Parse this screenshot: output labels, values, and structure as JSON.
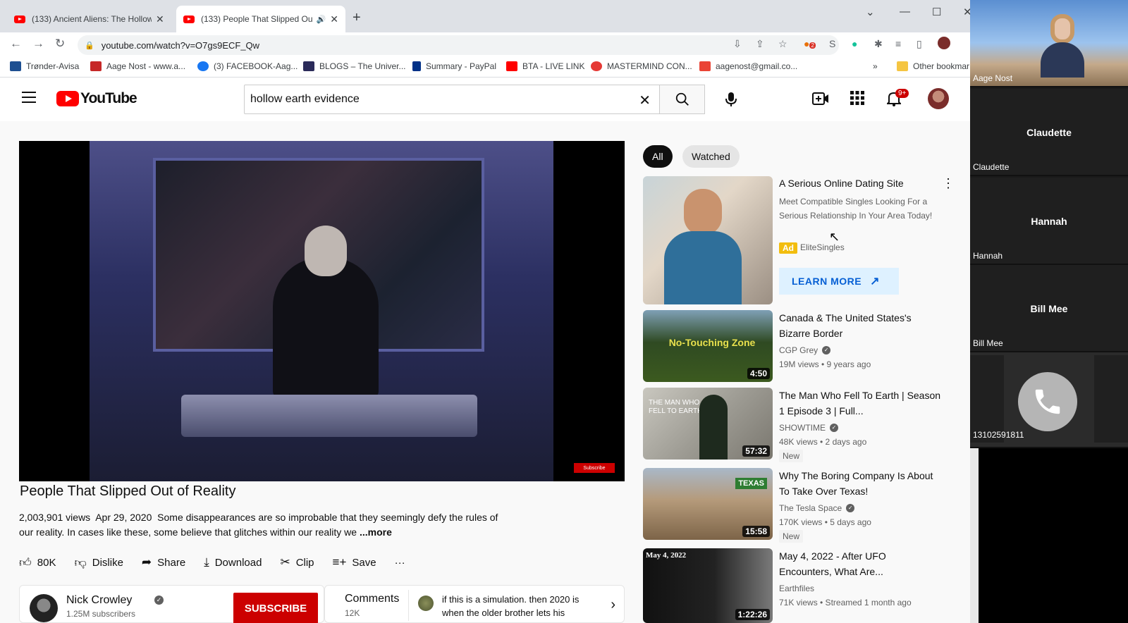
{
  "browser": {
    "tabs": [
      {
        "title": "(133) Ancient Aliens: The Hollow",
        "active": false
      },
      {
        "title": "(133) People That Slipped Ou",
        "active": true
      }
    ],
    "url": "youtube.com/watch?v=O7gs9ECF_Qw",
    "bookmarks": [
      {
        "label": "Trønder-Avisa",
        "color": "#1d4f91"
      },
      {
        "label": "Aage Nost - www.a...",
        "color": "#c62828"
      },
      {
        "label": "(3) FACEBOOK-Aag...",
        "color": "#1877f2"
      },
      {
        "label": "BLOGS – The Univer...",
        "color": "#2b2b5a"
      },
      {
        "label": "Summary - PayPal",
        "color": "#003087"
      },
      {
        "label": "BTA - LIVE LINK",
        "color": "#ff0000"
      },
      {
        "label": "MASTERMIND CON...",
        "color": "#e53935"
      },
      {
        "label": "aagenost@gmail.co...",
        "color": "#ea4335"
      }
    ],
    "other_bookmarks": "Other bookmar",
    "ext_badge": "2"
  },
  "youtube": {
    "logo": "YouTube",
    "search_query": "hollow earth evidence",
    "notifications_badge": "9+",
    "video": {
      "title": "People That Slipped Out of Reality",
      "views": "2,003,901 views",
      "date": "Apr 29, 2020",
      "description": "Some disappearances are so improbable that they seemingly defy the rules of our reality. In cases like these, some believe that glitches within our reality we",
      "more": "...more",
      "player_badge": "Subscribe"
    },
    "actions": {
      "likes": "80K",
      "dislike": "Dislike",
      "share": "Share",
      "download": "Download",
      "clip": "Clip",
      "save": "Save"
    },
    "channel": {
      "name": "Nick Crowley",
      "subscribers": "1.25M subscribers",
      "subscribe": "SUBSCRIBE"
    },
    "comments": {
      "label": "Comments",
      "count": "12K",
      "preview": "if this is a simulation. then 2020 is when the older brother lets his"
    },
    "chips": [
      "All",
      "Watched"
    ],
    "ad": {
      "title": "A Serious Online Dating Site",
      "description": "Meet Compatible Singles Looking For a Serious Relationship In Your Area Today!",
      "badge": "Ad",
      "advertiser": "EliteSingles",
      "cta": "LEARN MORE"
    },
    "related": [
      {
        "title": "Canada & The United States's Bizarre Border",
        "channel": "CGP Grey",
        "verified": true,
        "meta": "19M views • 9 years ago",
        "duration": "4:50",
        "new": "",
        "thumb_text": "No-Touching Zone"
      },
      {
        "title": "The Man Who Fell To Earth | Season 1 Episode 3 | Full...",
        "channel": "SHOWTIME",
        "verified": true,
        "meta": "48K views • 2 days ago",
        "duration": "57:32",
        "new": "New",
        "thumb_text": "THE MAN WHO FELL TO EARTH"
      },
      {
        "title": "Why The Boring Company Is About To Take Over Texas!",
        "channel": "The Tesla Space",
        "verified": true,
        "meta": "170K views • 5 days ago",
        "duration": "15:58",
        "new": "New",
        "thumb_text": "TEXAS"
      },
      {
        "title": "May 4, 2022 - After UFO Encounters, What Are...",
        "channel": "Earthfiles",
        "verified": false,
        "meta": "71K views • Streamed 1 month ago",
        "duration": "1:22:26",
        "new": "",
        "thumb_text": "May 4, 2022"
      }
    ]
  },
  "call": {
    "participants": [
      {
        "label": "Aage Nost"
      },
      {
        "name": "Claudette",
        "label": "Claudette"
      },
      {
        "name": "Hannah",
        "label": "Hannah"
      },
      {
        "name": "Bill Mee",
        "label": "Bill Mee"
      },
      {
        "label": "13102591811"
      }
    ]
  }
}
